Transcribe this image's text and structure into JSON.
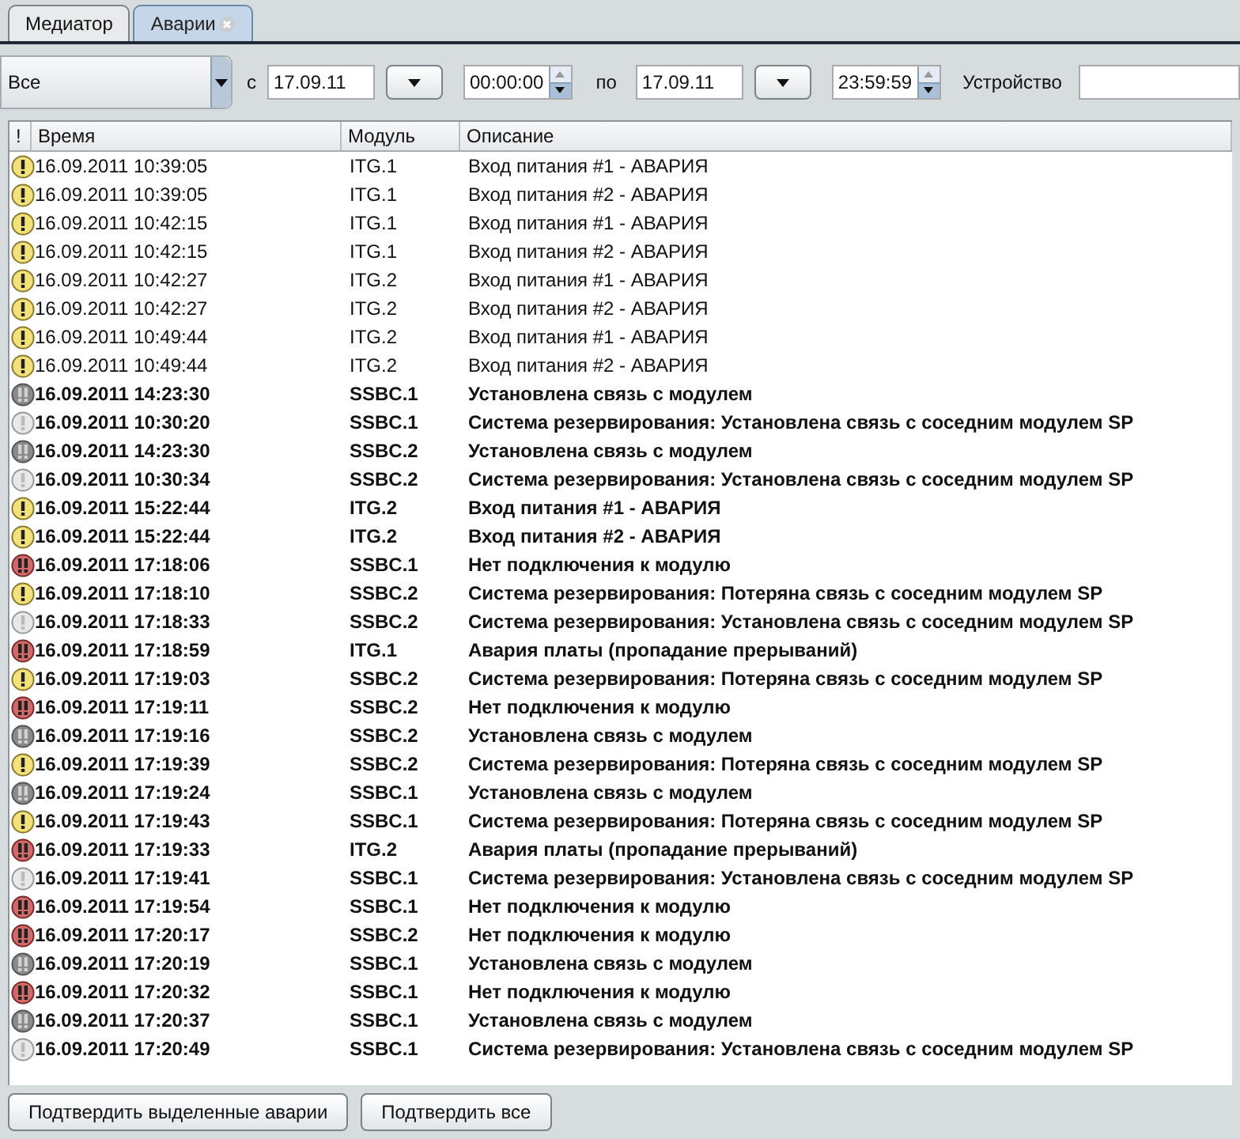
{
  "tabs": [
    {
      "label": "Медиатор",
      "selected": false,
      "closable": false
    },
    {
      "label": "Аварии",
      "selected": true,
      "closable": true
    }
  ],
  "filter": {
    "type_select": "Все",
    "from_label": "с",
    "from_date": "17.09.11",
    "from_time": "00:00:00",
    "to_label": "по",
    "to_date": "17.09.11",
    "to_time": "23:59:59",
    "device_label": "Устройство"
  },
  "table": {
    "columns": [
      "!",
      "Время",
      "Модуль",
      "Описание"
    ],
    "rows": [
      {
        "kind": "warning",
        "confirmed": true,
        "time": "16.09.2011 10:39:05",
        "module": "ITG.1",
        "description": "Вход питания #1 - АВАРИЯ"
      },
      {
        "kind": "warning",
        "confirmed": true,
        "time": "16.09.2011 10:39:05",
        "module": "ITG.1",
        "description": "Вход питания #2 - АВАРИЯ"
      },
      {
        "kind": "warning",
        "confirmed": true,
        "time": "16.09.2011 10:42:15",
        "module": "ITG.1",
        "description": "Вход питания #1 - АВАРИЯ"
      },
      {
        "kind": "warning",
        "confirmed": true,
        "time": "16.09.2011 10:42:15",
        "module": "ITG.1",
        "description": "Вход питания #2 - АВАРИЯ"
      },
      {
        "kind": "warning",
        "confirmed": true,
        "time": "16.09.2011 10:42:27",
        "module": "ITG.2",
        "description": "Вход питания #1 - АВАРИЯ"
      },
      {
        "kind": "warning",
        "confirmed": true,
        "time": "16.09.2011 10:42:27",
        "module": "ITG.2",
        "description": "Вход питания #2 - АВАРИЯ"
      },
      {
        "kind": "warning",
        "confirmed": true,
        "time": "16.09.2011 10:49:44",
        "module": "ITG.2",
        "description": "Вход питания #1 - АВАРИЯ"
      },
      {
        "kind": "warning",
        "confirmed": true,
        "time": "16.09.2011 10:49:44",
        "module": "ITG.2",
        "description": "Вход питания #2 - АВАРИЯ"
      },
      {
        "kind": "major",
        "confirmed": false,
        "time": "16.09.2011 14:23:30",
        "module": "SSBC.1",
        "description": "Установлена связь с модулем"
      },
      {
        "kind": "info",
        "confirmed": false,
        "time": "16.09.2011 10:30:20",
        "module": "SSBC.1",
        "description": "Система резервирования: Установлена связь с соседним модулем SP"
      },
      {
        "kind": "major",
        "confirmed": false,
        "time": "16.09.2011 14:23:30",
        "module": "SSBC.2",
        "description": "Установлена связь с модулем"
      },
      {
        "kind": "info",
        "confirmed": false,
        "time": "16.09.2011 10:30:34",
        "module": "SSBC.2",
        "description": "Система резервирования: Установлена связь с соседним модулем SP"
      },
      {
        "kind": "warning",
        "confirmed": false,
        "time": "16.09.2011 15:22:44",
        "module": "ITG.2",
        "description": "Вход питания #1 - АВАРИЯ"
      },
      {
        "kind": "warning",
        "confirmed": false,
        "time": "16.09.2011 15:22:44",
        "module": "ITG.2",
        "description": "Вход питания #2 - АВАРИЯ"
      },
      {
        "kind": "critical",
        "confirmed": false,
        "time": "16.09.2011 17:18:06",
        "module": "SSBC.1",
        "description": "Нет подключения к модулю"
      },
      {
        "kind": "warning",
        "confirmed": false,
        "time": "16.09.2011 17:18:10",
        "module": "SSBC.2",
        "description": "Система резервирования: Потеряна связь с соседним модулем SP"
      },
      {
        "kind": "info",
        "confirmed": false,
        "time": "16.09.2011 17:18:33",
        "module": "SSBC.2",
        "description": "Система резервирования: Установлена связь с соседним модулем SP"
      },
      {
        "kind": "critical",
        "confirmed": false,
        "time": "16.09.2011 17:18:59",
        "module": "ITG.1",
        "description": "Авария платы (пропадание прерываний)"
      },
      {
        "kind": "warning",
        "confirmed": false,
        "time": "16.09.2011 17:19:03",
        "module": "SSBC.2",
        "description": "Система резервирования: Потеряна связь с соседним модулем SP"
      },
      {
        "kind": "critical",
        "confirmed": false,
        "time": "16.09.2011 17:19:11",
        "module": "SSBC.2",
        "description": "Нет подключения к модулю"
      },
      {
        "kind": "major",
        "confirmed": false,
        "time": "16.09.2011 17:19:16",
        "module": "SSBC.2",
        "description": "Установлена связь с модулем"
      },
      {
        "kind": "warning",
        "confirmed": false,
        "time": "16.09.2011 17:19:39",
        "module": "SSBC.2",
        "description": "Система резервирования: Потеряна связь с соседним модулем SP"
      },
      {
        "kind": "major",
        "confirmed": false,
        "time": "16.09.2011 17:19:24",
        "module": "SSBC.1",
        "description": "Установлена связь с модулем"
      },
      {
        "kind": "warning",
        "confirmed": false,
        "time": "16.09.2011 17:19:43",
        "module": "SSBC.1",
        "description": "Система резервирования: Потеряна связь с соседним модулем SP"
      },
      {
        "kind": "critical",
        "confirmed": false,
        "time": "16.09.2011 17:19:33",
        "module": "ITG.2",
        "description": "Авария платы (пропадание прерываний)"
      },
      {
        "kind": "info",
        "confirmed": false,
        "time": "16.09.2011 17:19:41",
        "module": "SSBC.1",
        "description": "Система резервирования: Установлена связь с соседним модулем SP"
      },
      {
        "kind": "critical",
        "confirmed": false,
        "time": "16.09.2011 17:19:54",
        "module": "SSBC.1",
        "description": "Нет подключения к модулю"
      },
      {
        "kind": "critical",
        "confirmed": false,
        "time": "16.09.2011 17:20:17",
        "module": "SSBC.2",
        "description": "Нет подключения к модулю"
      },
      {
        "kind": "major",
        "confirmed": false,
        "time": "16.09.2011 17:20:19",
        "module": "SSBC.1",
        "description": "Установлена связь с модулем"
      },
      {
        "kind": "critical",
        "confirmed": false,
        "time": "16.09.2011 17:20:32",
        "module": "SSBC.1",
        "description": "Нет подключения к модулю"
      },
      {
        "kind": "major",
        "confirmed": false,
        "time": "16.09.2011 17:20:37",
        "module": "SSBC.1",
        "description": "Установлена связь с модулем"
      },
      {
        "kind": "info",
        "confirmed": false,
        "time": "16.09.2011 17:20:49",
        "module": "SSBC.1",
        "description": "Система резервирования: Установлена связь с соседним модулем SP"
      }
    ]
  },
  "buttons": [
    "Подтвердить выделенные аварии",
    "Подтвердить все"
  ]
}
